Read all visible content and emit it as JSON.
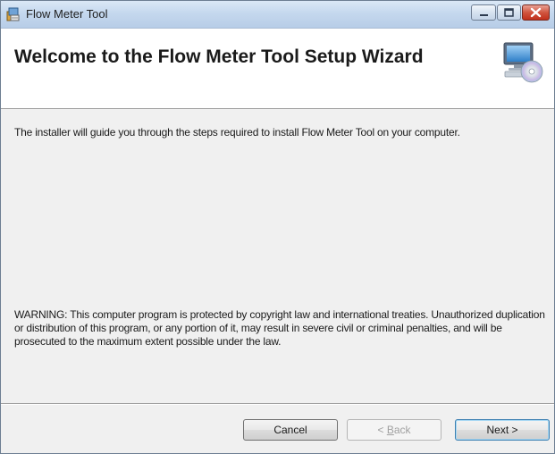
{
  "window": {
    "title": "Flow Meter Tool"
  },
  "header": {
    "title": "Welcome to the Flow Meter Tool Setup Wizard",
    "icon": "computer-cd-icon"
  },
  "body": {
    "intro": "The installer will guide you through the steps required to install Flow Meter Tool on your computer.",
    "warning": "WARNING: This computer program is protected by copyright law and international treaties. Unauthorized duplication or distribution of this program, or any portion of it, may result in severe civil or criminal penalties, and will be prosecuted to the maximum extent possible under the law."
  },
  "buttons": {
    "cancel": "Cancel",
    "back_prefix": "< ",
    "back_mnemonic": "B",
    "back_rest": "ack",
    "next": "Next >",
    "back_enabled": false
  },
  "caption_buttons": {
    "minimize": "minimize-icon",
    "maximize": "maximize-icon",
    "close": "close-icon"
  }
}
